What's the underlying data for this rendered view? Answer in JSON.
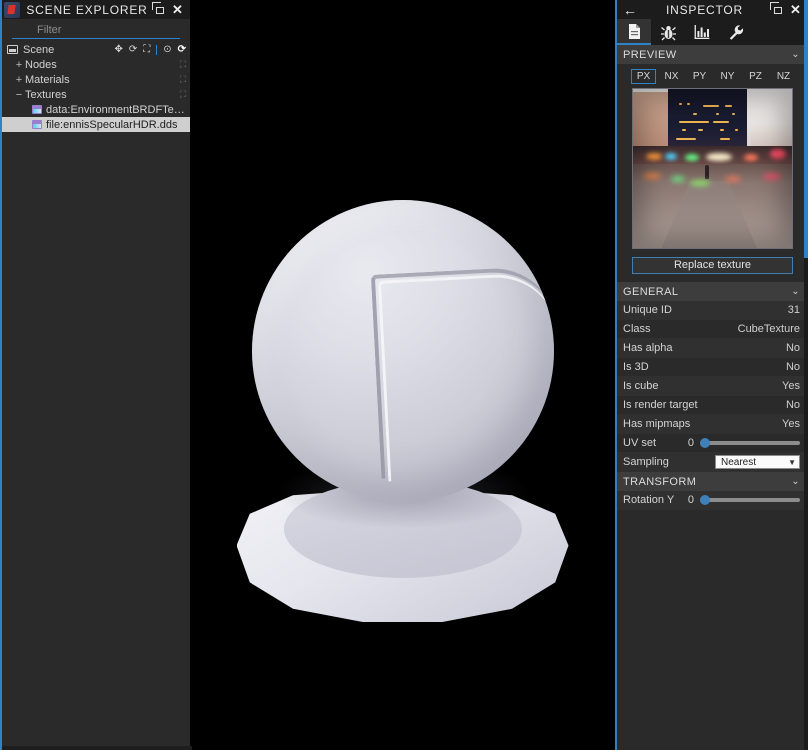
{
  "app": {
    "logo_icon": "babylon-logo-icon",
    "background_color": "#000000",
    "accent_color": "#2e83c8",
    "panel_color": "#2a2a2a"
  },
  "scene_explorer": {
    "title": "SCENE EXPLORER",
    "popout_icon": "popout-icon",
    "close_icon": "close-icon",
    "filter": {
      "value": "",
      "placeholder": "Filter"
    },
    "root": {
      "label": "Scene",
      "icon": "scene-icon",
      "tools": [
        {
          "name": "position-gizmo-icon",
          "glyph": "✥",
          "active": false
        },
        {
          "name": "rotation-gizmo-icon",
          "glyph": "⟳",
          "active": false
        },
        {
          "name": "scale-gizmo-icon",
          "glyph": "⛶",
          "active": false
        },
        {
          "name": "bounding-box-gizmo-icon",
          "glyph": "⊙",
          "active": false
        },
        {
          "name": "refresh-icon",
          "glyph": "⟳",
          "active": true
        }
      ]
    },
    "tree": [
      {
        "label": "Nodes",
        "expander": "+",
        "indent": 1,
        "icon": "none",
        "tool": "⛶",
        "selected": false
      },
      {
        "label": "Materials",
        "expander": "+",
        "indent": 1,
        "icon": "none",
        "tool": "⛶",
        "selected": false
      },
      {
        "label": "Textures",
        "expander": "−",
        "indent": 1,
        "icon": "none",
        "tool": "⛶",
        "selected": false
      },
      {
        "label": "data:EnvironmentBRDFTexture",
        "expander": "",
        "indent": 2,
        "icon": "texture-icon",
        "tool": "",
        "selected": false
      },
      {
        "label": "file:ennisSpecularHDR.dds",
        "expander": "",
        "indent": 2,
        "icon": "texture-icon",
        "tool": "",
        "selected": true
      }
    ]
  },
  "inspector": {
    "title": "INSPECTOR",
    "back_icon": "back-arrow-icon",
    "popout_icon": "popout-icon",
    "close_icon": "close-icon",
    "tabs": [
      {
        "name": "properties",
        "icon": "document-icon",
        "active": true
      },
      {
        "name": "debug",
        "icon": "bug-icon",
        "active": false
      },
      {
        "name": "statistics",
        "icon": "chart-icon",
        "active": false
      },
      {
        "name": "tools",
        "icon": "wrench-icon",
        "active": false
      }
    ],
    "preview": {
      "header": "PREVIEW",
      "collapse_icon": "chevron-down-icon",
      "faces": [
        {
          "label": "PX",
          "active": true
        },
        {
          "label": "NX",
          "active": false
        },
        {
          "label": "PY",
          "active": false
        },
        {
          "label": "NY",
          "active": false
        },
        {
          "label": "PZ",
          "active": false
        },
        {
          "label": "NZ",
          "active": false
        }
      ],
      "image_alt": "night city square HDR environment face",
      "replace_button": "Replace texture"
    },
    "general": {
      "header": "GENERAL",
      "collapse_icon": "chevron-down-icon",
      "rows": [
        {
          "label": "Unique ID",
          "value": "31",
          "type": "text"
        },
        {
          "label": "Class",
          "value": "CubeTexture",
          "type": "text"
        },
        {
          "label": "Has alpha",
          "value": "No",
          "type": "text"
        },
        {
          "label": "Is 3D",
          "value": "No",
          "type": "text"
        },
        {
          "label": "Is cube",
          "value": "Yes",
          "type": "text"
        },
        {
          "label": "Is render target",
          "value": "No",
          "type": "text"
        },
        {
          "label": "Has mipmaps",
          "value": "Yes",
          "type": "text"
        },
        {
          "label": "UV set",
          "value": "0",
          "type": "slider",
          "percent": 0
        },
        {
          "label": "Sampling",
          "value": "Nearest",
          "type": "select",
          "caret_icon": "caret-down-icon"
        }
      ]
    },
    "transform": {
      "header": "TRANSFORM",
      "collapse_icon": "chevron-down-icon",
      "rows": [
        {
          "label": "Rotation Y",
          "value": "0",
          "type": "slider",
          "percent": 0
        }
      ]
    }
  },
  "viewport": {
    "name": "3d-render-viewport",
    "description": "material preview sphere on pedestal"
  }
}
